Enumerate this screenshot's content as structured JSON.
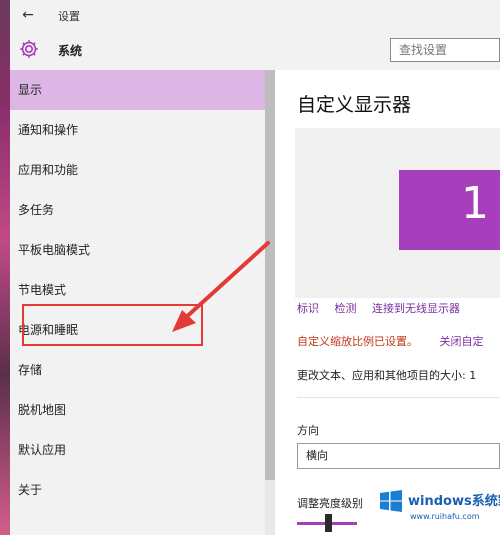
{
  "titlebar": {
    "title": "设置"
  },
  "header": {
    "title": "系统",
    "search_placeholder": "查找设置"
  },
  "sidebar": {
    "items": [
      {
        "label": "显示",
        "selected": true
      },
      {
        "label": "通知和操作"
      },
      {
        "label": "应用和功能"
      },
      {
        "label": "多任务"
      },
      {
        "label": "平板电脑模式"
      },
      {
        "label": "节电模式"
      },
      {
        "label": "电源和睡眠",
        "highlighted": true
      },
      {
        "label": "存储"
      },
      {
        "label": "脱机地图"
      },
      {
        "label": "默认应用"
      },
      {
        "label": "关于"
      }
    ]
  },
  "content": {
    "title": "自定义显示器",
    "monitor_number": "1",
    "links": [
      "标识",
      "检测",
      "连接到无线显示器"
    ],
    "warning": "自定义缩放比例已设置。",
    "signout_link": "关闭自定",
    "scale_desc": "更改文本、应用和其他项目的大小: 1",
    "orientation_label": "方向",
    "orientation_value": "横向",
    "brightness_label": "调整亮度级别"
  },
  "watermark": {
    "text": "windows系统家园",
    "sub": "www.ruihafu.com"
  },
  "colors": {
    "accent": "#a73fbd",
    "selected_bg": "#dcb7e6",
    "warning": "#c0391b",
    "annotation": "#e53935"
  }
}
